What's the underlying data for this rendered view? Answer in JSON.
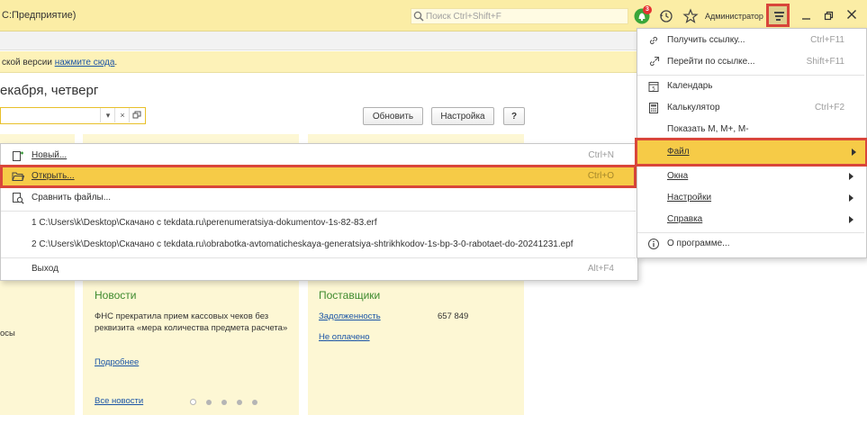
{
  "titlebar": {
    "app_title": "С:Предприятие)",
    "search_placeholder": "Поиск Ctrl+Shift+F",
    "notification_count": "3",
    "user_name": "Администратор"
  },
  "banner": {
    "text": "ской версии ",
    "link": "нажмите сюда",
    "suffix": "."
  },
  "page": {
    "heading": "екабря, четверг"
  },
  "toolbar": {
    "combo_dropdown": "▾",
    "combo_clear": "×",
    "refresh_label": "Обновить",
    "settings_label": "Настройка",
    "help_label": "?"
  },
  "file_menu": {
    "items": [
      {
        "label": "Новый...",
        "shortcut": "Ctrl+N",
        "icon": "new-file-icon"
      },
      {
        "label": "Открыть...",
        "shortcut": "Ctrl+O",
        "icon": "open-folder-icon"
      },
      {
        "label": "Сравнить файлы...",
        "shortcut": "",
        "icon": "compare-files-icon"
      },
      {
        "label": "1 C:\\Users\\k\\Desktop\\Скачано с tekdata.ru\\perenumeratsiya-dokumentov-1s-82-83.erf",
        "shortcut": ""
      },
      {
        "label": "2 C:\\Users\\k\\Desktop\\Скачано с tekdata.ru\\obrabotka-avtomaticheskaya-generatsiya-shtrikhkodov-1s-bp-3-0-rabotaet-do-20241231.epf",
        "shortcut": ""
      },
      {
        "label": "Выход",
        "shortcut": "Alt+F4"
      }
    ]
  },
  "main_menu": {
    "items": [
      {
        "label": "Получить ссылку...",
        "shortcut": "Ctrl+F11",
        "icon": "link-icon"
      },
      {
        "label": "Перейти по ссылке...",
        "shortcut": "Shift+F11",
        "icon": "goto-link-icon"
      },
      {
        "label": "Календарь",
        "shortcut": "",
        "icon": "calendar-icon"
      },
      {
        "label": "Калькулятор",
        "shortcut": "Ctrl+F2",
        "icon": "calculator-icon"
      },
      {
        "label": "Показать М, М+, М-",
        "shortcut": ""
      },
      {
        "label": "Файл",
        "shortcut": ""
      },
      {
        "label": "Окна",
        "shortcut": ""
      },
      {
        "label": "Настройки",
        "shortcut": ""
      },
      {
        "label": "Справка",
        "shortcut": ""
      },
      {
        "label": "О программе...",
        "shortcut": "",
        "icon": "info-icon"
      }
    ]
  },
  "news": {
    "title": "Новости",
    "text": "ФНС прекратила прием кассовых чеков без реквизита «мера количества предмета расчета»",
    "more_link": "Подробнее",
    "all_link": "Все новости"
  },
  "suppliers": {
    "title": "Поставщики",
    "debt_label": "Задолженность",
    "debt_value": "657 849",
    "unpaid_label": "Не оплачено"
  },
  "left_card": {
    "fragment": "осы"
  },
  "colors": {
    "accent_yellow": "#f6cb47",
    "highlight_red": "#d9463a",
    "link_blue": "#1b55a6",
    "title_green": "#3d8a2e"
  }
}
